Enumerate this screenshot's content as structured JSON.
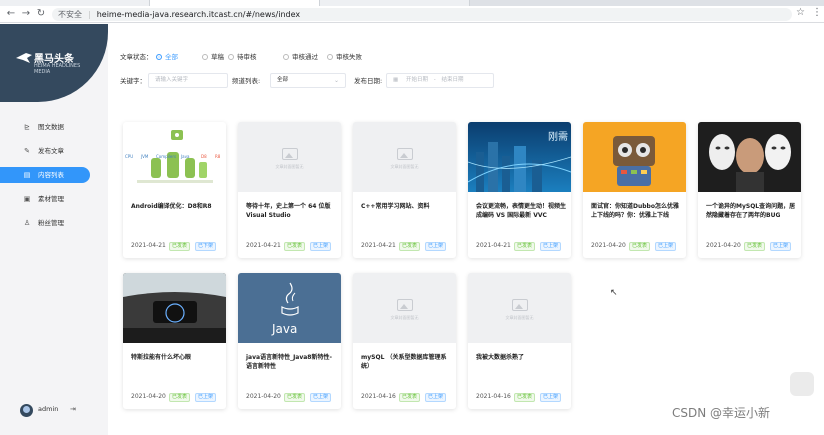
{
  "browser": {
    "security_label": "不安全",
    "url": "heime-media-java.research.itcast.cn/#/news/index"
  },
  "brand": {
    "title": "黑马头条",
    "subtitle": "HEIMA HEADLINES MEDIA"
  },
  "sidebar": {
    "items": [
      {
        "label": "图文数据",
        "icon": "chart-icon"
      },
      {
        "label": "发布文章",
        "icon": "edit-icon"
      },
      {
        "label": "内容列表",
        "icon": "list-icon"
      },
      {
        "label": "素材管理",
        "icon": "image-icon"
      },
      {
        "label": "粉丝管理",
        "icon": "user-icon"
      }
    ],
    "active_index": 2,
    "user_name": "admin"
  },
  "filters": {
    "status_label": "文章状态：",
    "status_options": [
      "全部",
      "草稿",
      "待审核",
      "审核通过",
      "审核失败"
    ],
    "status_selected": 0,
    "keyword_label": "关键字：",
    "keyword_placeholder": "请输入关键字",
    "channel_label": "频道列表:",
    "channel_value": "全部",
    "date_label": "发布日期:",
    "date_start_placeholder": "开始日期",
    "date_separator": "-",
    "date_end_placeholder": "结束日期"
  },
  "placeholder_text": "文章封面图暂无",
  "cards": [
    {
      "title": "Android编译优化：D8和R8",
      "date": "2021-04-21",
      "tag1": "已发表",
      "tag2": "已下架",
      "thumb": "android"
    },
    {
      "title": "等待十年，史上第一个 64 位版 Visual Studio",
      "date": "2021-04-21",
      "tag1": "已发表",
      "tag2": "已上架",
      "thumb": "placeholder"
    },
    {
      "title": "C++常用学习网站、资料",
      "date": "2021-04-21",
      "tag1": "已发表",
      "tag2": "已上架",
      "thumb": "placeholder"
    },
    {
      "title": "会议更流畅，表情更生动！视频生成编码 VS 国际最新 VVC",
      "date": "2021-04-21",
      "tag1": "已发表",
      "tag2": "已上架",
      "thumb": "city"
    },
    {
      "title": "面试官：你知道Dubbo怎么优雅上下线的吗？你：优雅上下线",
      "date": "2021-04-20",
      "tag1": "已发表",
      "tag2": "已上架",
      "thumb": "robot"
    },
    {
      "title": "一个诡异的MySQL查询问题，居然隐藏着存在了两年的BUG",
      "date": "2021-04-20",
      "tag1": "已发表",
      "tag2": "已上架",
      "thumb": "masks"
    },
    {
      "title": "特斯拉能有什么坏心眼",
      "date": "2021-04-20",
      "tag1": "已发表",
      "tag2": "已上架",
      "thumb": "car"
    },
    {
      "title": "java语言新特性_Java8新特性-语言新特性",
      "date": "2021-04-20",
      "tag1": "已发表",
      "tag2": "已上架",
      "thumb": "java"
    },
    {
      "title": "mySQL （关系型数据库管理系统）",
      "date": "2021-04-16",
      "tag1": "已发表",
      "tag2": "已上架",
      "thumb": "placeholder"
    },
    {
      "title": "我被大数据杀熟了",
      "date": "2021-04-16",
      "tag1": "已发表",
      "tag2": "已上架",
      "thumb": "placeholder"
    }
  ],
  "thumb_texts": {
    "android_labels": [
      "CPU",
      "JVM",
      "Compilers",
      "Java",
      "D8",
      "R8"
    ],
    "city_text": "刚需",
    "java_text": "Java"
  },
  "watermark": "CSDN @幸运小新",
  "colors": {
    "sidebar_header": "#34495e",
    "active_item": "#3296fa",
    "tag_green": "#67c23a",
    "tag_blue": "#409eff"
  }
}
